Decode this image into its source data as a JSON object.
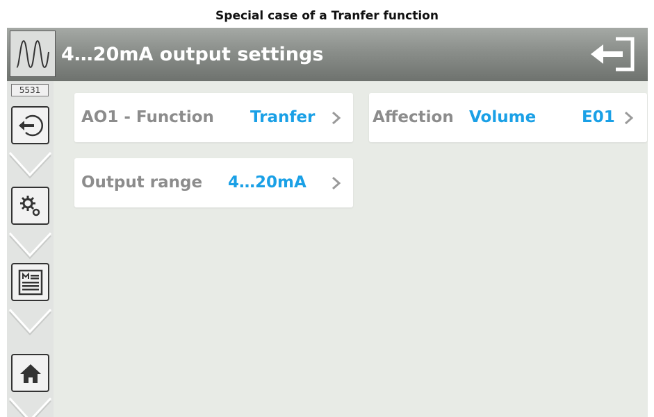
{
  "caption": "Special case of a Tranfer function",
  "header": {
    "title": "4…20mA output settings",
    "icon": "sine-wave-icon",
    "exit_icon": "exit-icon"
  },
  "sidebar": {
    "code": "5531",
    "buttons": [
      {
        "name": "login-icon"
      },
      {
        "name": "gears-icon"
      },
      {
        "name": "menu-document-icon"
      },
      {
        "name": "home-icon"
      }
    ]
  },
  "settings": {
    "function": {
      "label": "AO1 - Function",
      "value": "Tranfer"
    },
    "affection": {
      "label": "Affection",
      "value": "Volume",
      "code": "E01"
    },
    "range": {
      "label": "Output range",
      "value": "4…20mA"
    }
  },
  "colors": {
    "accent": "#1aa0e6",
    "label": "#8c8c8c",
    "titlebar": "#8a8e8a",
    "background": "#e8ebe6"
  }
}
